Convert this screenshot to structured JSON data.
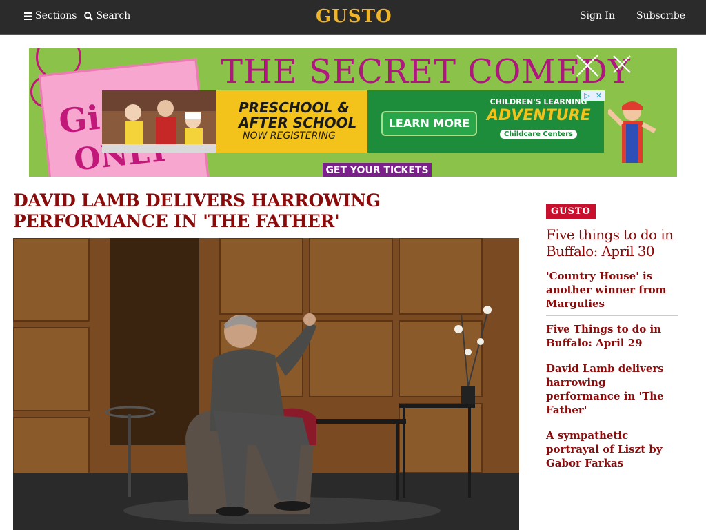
{
  "header": {
    "sections_label": "Sections",
    "search_label": "Search",
    "logo": "GUSTO",
    "sign_in": "Sign In",
    "subscribe": "Subscribe"
  },
  "ad": {
    "title": "THE SECRET COMEDY",
    "book_text_1": "Gi",
    "book_text_2": "ONLY",
    "tickets": "GET YOUR TICKETS",
    "inner": {
      "line1": "PRESCHOOL &",
      "line2": "AFTER SCHOOL",
      "line3": "NOW REGISTERING",
      "cta": "LEARN MORE",
      "brand_top": "CHILDREN'S LEARNING",
      "brand_main": "ADVENTURE",
      "brand_sub": "Childcare Centers"
    },
    "adchoices_icon": "adchoices-icon",
    "close_icon": "close-icon"
  },
  "article": {
    "headline": "DAVID LAMB DELIVERS HARROWING PERFORMANCE IN 'THE FATHER'"
  },
  "sidebar": {
    "tag": "GUSTO",
    "feature": "Five things to do in Buffalo: April 30",
    "items": [
      {
        "label": "'Country House' is another winner from Margulies"
      },
      {
        "label": "Five Things to do in Buffalo: April 29"
      },
      {
        "label": "David Lamb delivers harrowing performance in 'The Father'"
      },
      {
        "label": "A sympathetic portrayal of Liszt by Gabor Farkas"
      }
    ]
  },
  "colors": {
    "topbar": "#2b2b2b",
    "logo": "#f0b428",
    "headline": "#8b0a0a",
    "tag": "#c8102e"
  }
}
